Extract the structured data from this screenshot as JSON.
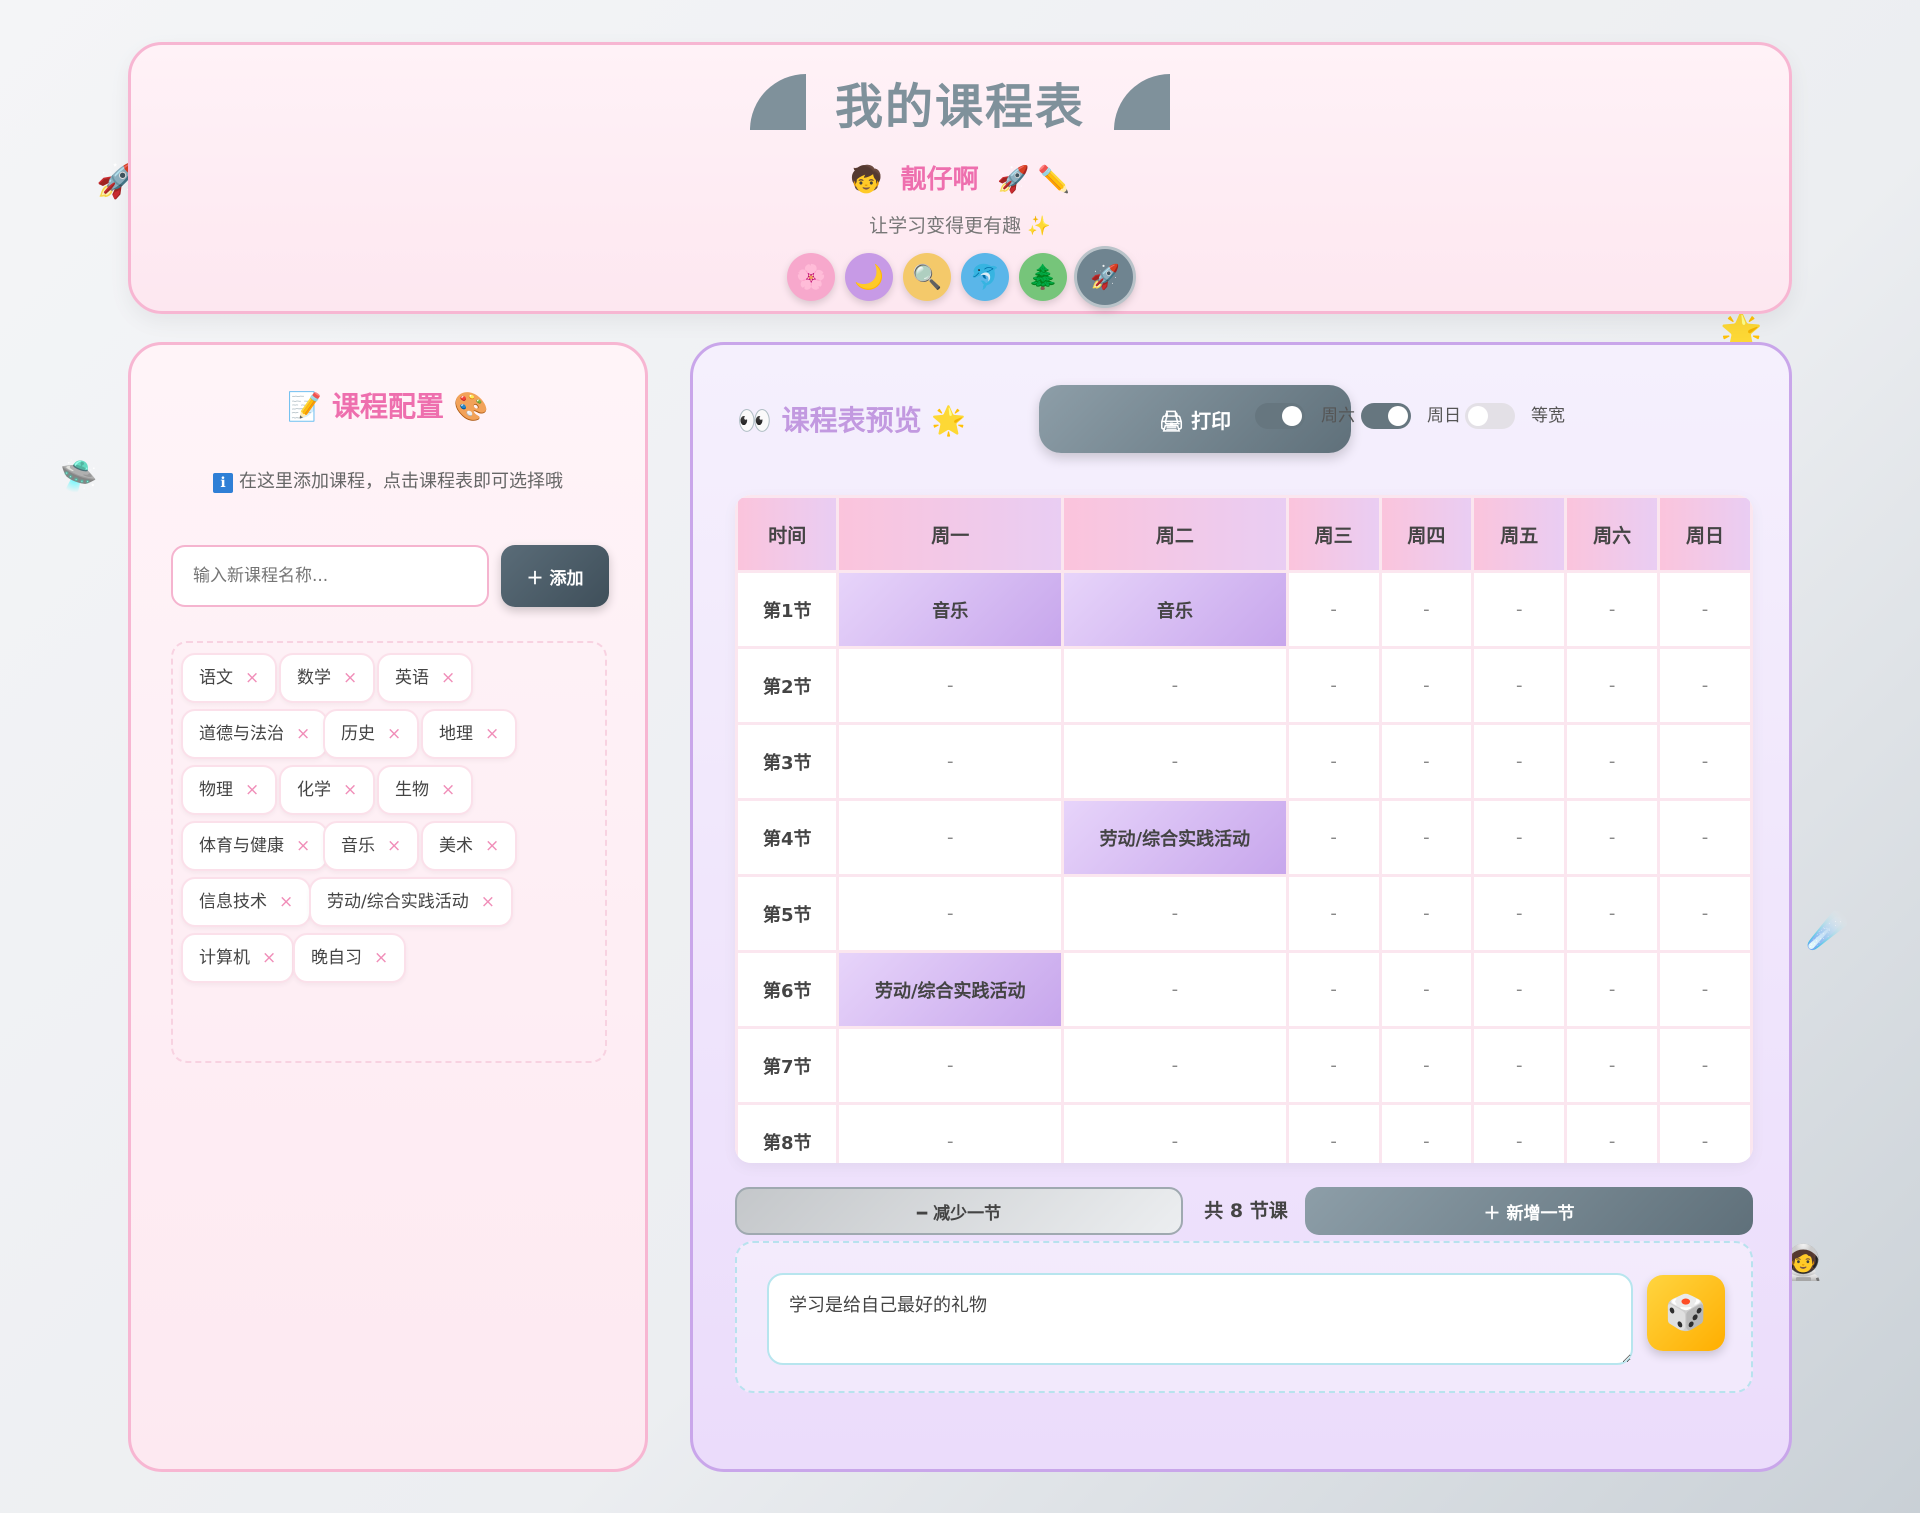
{
  "header": {
    "title": "我的课程表",
    "author_left_emoji": "🧒",
    "author": "靓仔啊",
    "author_right_emoji": "🚀 ✏️",
    "subtitle": "让学习变得更有趣 ✨",
    "themes": [
      {
        "name": "sakura",
        "glyph": "🌸",
        "color": "#f7a8cc"
      },
      {
        "name": "moon",
        "glyph": "🌙",
        "color": "#c79ae6"
      },
      {
        "name": "magnifier",
        "glyph": "🔍",
        "color": "#f4c96a"
      },
      {
        "name": "dolphin",
        "glyph": "🐬",
        "color": "#5ab6e9"
      },
      {
        "name": "tree",
        "glyph": "🌲",
        "color": "#76c57a"
      },
      {
        "name": "rocket",
        "glyph": "🚀",
        "color": "#6f8490"
      }
    ]
  },
  "config": {
    "title": "📝 课程配置 🎨",
    "hint": "在这里添加课程，点击课程表即可选择哦",
    "hint_icon": "ℹ",
    "input_placeholder": "输入新课程名称...",
    "add_label": "＋ 添加",
    "courses": [
      "语文",
      "数学",
      "英语",
      "道德与法治",
      "历史",
      "地理",
      "物理",
      "化学",
      "生物",
      "体育与健康",
      "音乐",
      "美术",
      "信息技术",
      "劳动/综合实践活动",
      "计算机",
      "晚自习"
    ],
    "remove_glyph": "×"
  },
  "preview": {
    "title": "👀 课程表预览 🌟",
    "print_label": "🖨 打印",
    "toggles": [
      {
        "label": "周六",
        "on": true
      },
      {
        "label": "周日",
        "on": true
      },
      {
        "label": "等宽",
        "on": false
      }
    ],
    "headers": [
      "时间",
      "周一",
      "周二",
      "周三",
      "周四",
      "周五",
      "周六",
      "周日"
    ],
    "rows": [
      {
        "period": "第1节",
        "cells": [
          "音乐",
          "音乐",
          "-",
          "-",
          "-",
          "-",
          "-"
        ]
      },
      {
        "period": "第2节",
        "cells": [
          "-",
          "-",
          "-",
          "-",
          "-",
          "-",
          "-"
        ]
      },
      {
        "period": "第3节",
        "cells": [
          "-",
          "-",
          "-",
          "-",
          "-",
          "-",
          "-"
        ]
      },
      {
        "period": "第4节",
        "cells": [
          "-",
          "劳动/综合实践活动",
          "-",
          "-",
          "-",
          "-",
          "-"
        ]
      },
      {
        "period": "第5节",
        "cells": [
          "-",
          "-",
          "-",
          "-",
          "-",
          "-",
          "-"
        ]
      },
      {
        "period": "第6节",
        "cells": [
          "劳动/综合实践活动",
          "-",
          "-",
          "-",
          "-",
          "-",
          "-"
        ]
      },
      {
        "period": "第7节",
        "cells": [
          "-",
          "-",
          "-",
          "-",
          "-",
          "-",
          "-"
        ]
      },
      {
        "period": "第8节",
        "cells": [
          "-",
          "-",
          "-",
          "-",
          "-",
          "-",
          "-"
        ]
      }
    ],
    "minus_label": "━ 减少一节",
    "count_label": "共 8 节课",
    "plus_label": "＋ 新增一节",
    "quote": "学习是给自己最好的礼物",
    "dice_glyph": "🎲"
  },
  "floating": {
    "rocket": "🚀",
    "ufo": "🛸",
    "star": "🌟",
    "comet": "☄️",
    "astronaut": "🧑‍🚀"
  }
}
